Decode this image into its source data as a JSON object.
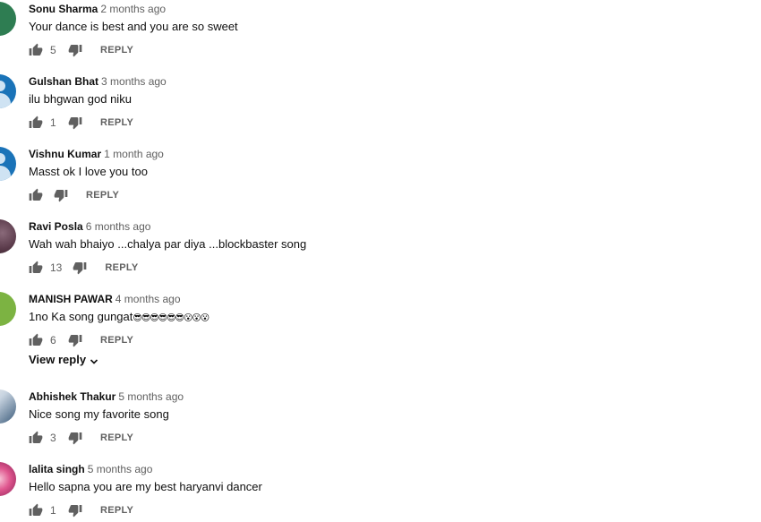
{
  "reply_label": "REPLY",
  "view_reply_label": "View reply",
  "comments": [
    {
      "author": "Sonu Sharma",
      "time": "2 months ago",
      "text": "Your dance is best and you are so sweet",
      "likes": "5"
    },
    {
      "author": "Gulshan Bhat",
      "time": "3 months ago",
      "text": "ilu bhgwan god niku",
      "likes": "1"
    },
    {
      "author": "Vishnu Kumar",
      "time": "1 month ago",
      "text": "Masst ok I love you too",
      "likes": ""
    },
    {
      "author": "Ravi Posla",
      "time": "6 months ago",
      "text": "Wah wah bhaiyo ...chalya par diya ...blockbaster song",
      "likes": "13"
    },
    {
      "author": "MANISH PAWAR",
      "time": "4 months ago",
      "text": "1no Ka song gungat",
      "emoji": "😎😎😎😎😎😎😮😮😮",
      "likes": "6"
    },
    {
      "author": "Abhishek Thakur",
      "time": "5 months ago",
      "text": "Nice song my favorite song",
      "likes": "3"
    },
    {
      "author": "lalita singh",
      "time": "5 months ago",
      "text": "Hello sapna you are my best haryanvi dancer",
      "likes": "1"
    }
  ],
  "colors": {
    "avatar_green": "#2e7d52",
    "avatar_blue": "#1a73b8",
    "avatar_lightgreen": "#7cb342",
    "meta_gray": "#606060"
  }
}
